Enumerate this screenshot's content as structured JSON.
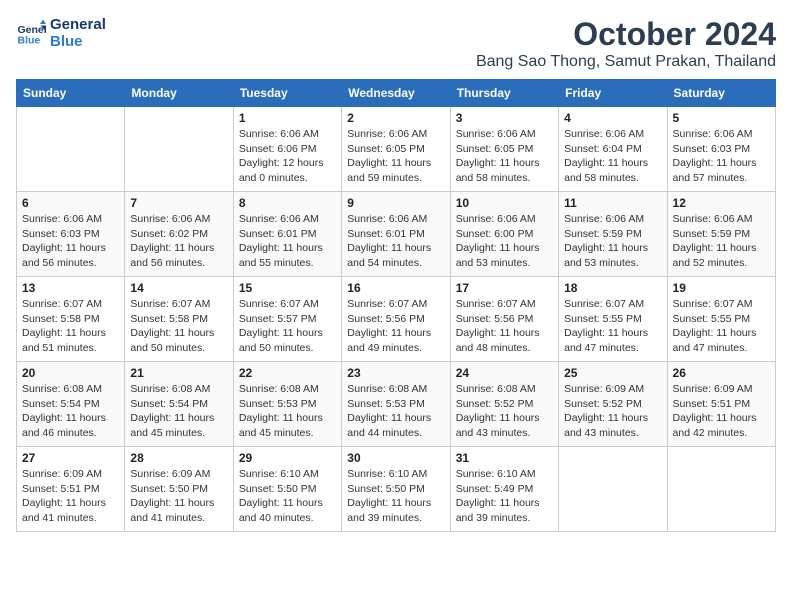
{
  "logo": {
    "line1": "General",
    "line2": "Blue"
  },
  "title": "October 2024",
  "location": "Bang Sao Thong, Samut Prakan, Thailand",
  "days_of_week": [
    "Sunday",
    "Monday",
    "Tuesday",
    "Wednesday",
    "Thursday",
    "Friday",
    "Saturday"
  ],
  "weeks": [
    [
      {
        "day": "",
        "info": ""
      },
      {
        "day": "",
        "info": ""
      },
      {
        "day": "1",
        "info": "Sunrise: 6:06 AM\nSunset: 6:06 PM\nDaylight: 12 hours\nand 0 minutes."
      },
      {
        "day": "2",
        "info": "Sunrise: 6:06 AM\nSunset: 6:05 PM\nDaylight: 11 hours\nand 59 minutes."
      },
      {
        "day": "3",
        "info": "Sunrise: 6:06 AM\nSunset: 6:05 PM\nDaylight: 11 hours\nand 58 minutes."
      },
      {
        "day": "4",
        "info": "Sunrise: 6:06 AM\nSunset: 6:04 PM\nDaylight: 11 hours\nand 58 minutes."
      },
      {
        "day": "5",
        "info": "Sunrise: 6:06 AM\nSunset: 6:03 PM\nDaylight: 11 hours\nand 57 minutes."
      }
    ],
    [
      {
        "day": "6",
        "info": "Sunrise: 6:06 AM\nSunset: 6:03 PM\nDaylight: 11 hours\nand 56 minutes."
      },
      {
        "day": "7",
        "info": "Sunrise: 6:06 AM\nSunset: 6:02 PM\nDaylight: 11 hours\nand 56 minutes."
      },
      {
        "day": "8",
        "info": "Sunrise: 6:06 AM\nSunset: 6:01 PM\nDaylight: 11 hours\nand 55 minutes."
      },
      {
        "day": "9",
        "info": "Sunrise: 6:06 AM\nSunset: 6:01 PM\nDaylight: 11 hours\nand 54 minutes."
      },
      {
        "day": "10",
        "info": "Sunrise: 6:06 AM\nSunset: 6:00 PM\nDaylight: 11 hours\nand 53 minutes."
      },
      {
        "day": "11",
        "info": "Sunrise: 6:06 AM\nSunset: 5:59 PM\nDaylight: 11 hours\nand 53 minutes."
      },
      {
        "day": "12",
        "info": "Sunrise: 6:06 AM\nSunset: 5:59 PM\nDaylight: 11 hours\nand 52 minutes."
      }
    ],
    [
      {
        "day": "13",
        "info": "Sunrise: 6:07 AM\nSunset: 5:58 PM\nDaylight: 11 hours\nand 51 minutes."
      },
      {
        "day": "14",
        "info": "Sunrise: 6:07 AM\nSunset: 5:58 PM\nDaylight: 11 hours\nand 50 minutes."
      },
      {
        "day": "15",
        "info": "Sunrise: 6:07 AM\nSunset: 5:57 PM\nDaylight: 11 hours\nand 50 minutes."
      },
      {
        "day": "16",
        "info": "Sunrise: 6:07 AM\nSunset: 5:56 PM\nDaylight: 11 hours\nand 49 minutes."
      },
      {
        "day": "17",
        "info": "Sunrise: 6:07 AM\nSunset: 5:56 PM\nDaylight: 11 hours\nand 48 minutes."
      },
      {
        "day": "18",
        "info": "Sunrise: 6:07 AM\nSunset: 5:55 PM\nDaylight: 11 hours\nand 47 minutes."
      },
      {
        "day": "19",
        "info": "Sunrise: 6:07 AM\nSunset: 5:55 PM\nDaylight: 11 hours\nand 47 minutes."
      }
    ],
    [
      {
        "day": "20",
        "info": "Sunrise: 6:08 AM\nSunset: 5:54 PM\nDaylight: 11 hours\nand 46 minutes."
      },
      {
        "day": "21",
        "info": "Sunrise: 6:08 AM\nSunset: 5:54 PM\nDaylight: 11 hours\nand 45 minutes."
      },
      {
        "day": "22",
        "info": "Sunrise: 6:08 AM\nSunset: 5:53 PM\nDaylight: 11 hours\nand 45 minutes."
      },
      {
        "day": "23",
        "info": "Sunrise: 6:08 AM\nSunset: 5:53 PM\nDaylight: 11 hours\nand 44 minutes."
      },
      {
        "day": "24",
        "info": "Sunrise: 6:08 AM\nSunset: 5:52 PM\nDaylight: 11 hours\nand 43 minutes."
      },
      {
        "day": "25",
        "info": "Sunrise: 6:09 AM\nSunset: 5:52 PM\nDaylight: 11 hours\nand 43 minutes."
      },
      {
        "day": "26",
        "info": "Sunrise: 6:09 AM\nSunset: 5:51 PM\nDaylight: 11 hours\nand 42 minutes."
      }
    ],
    [
      {
        "day": "27",
        "info": "Sunrise: 6:09 AM\nSunset: 5:51 PM\nDaylight: 11 hours\nand 41 minutes."
      },
      {
        "day": "28",
        "info": "Sunrise: 6:09 AM\nSunset: 5:50 PM\nDaylight: 11 hours\nand 41 minutes."
      },
      {
        "day": "29",
        "info": "Sunrise: 6:10 AM\nSunset: 5:50 PM\nDaylight: 11 hours\nand 40 minutes."
      },
      {
        "day": "30",
        "info": "Sunrise: 6:10 AM\nSunset: 5:50 PM\nDaylight: 11 hours\nand 39 minutes."
      },
      {
        "day": "31",
        "info": "Sunrise: 6:10 AM\nSunset: 5:49 PM\nDaylight: 11 hours\nand 39 minutes."
      },
      {
        "day": "",
        "info": ""
      },
      {
        "day": "",
        "info": ""
      }
    ]
  ]
}
